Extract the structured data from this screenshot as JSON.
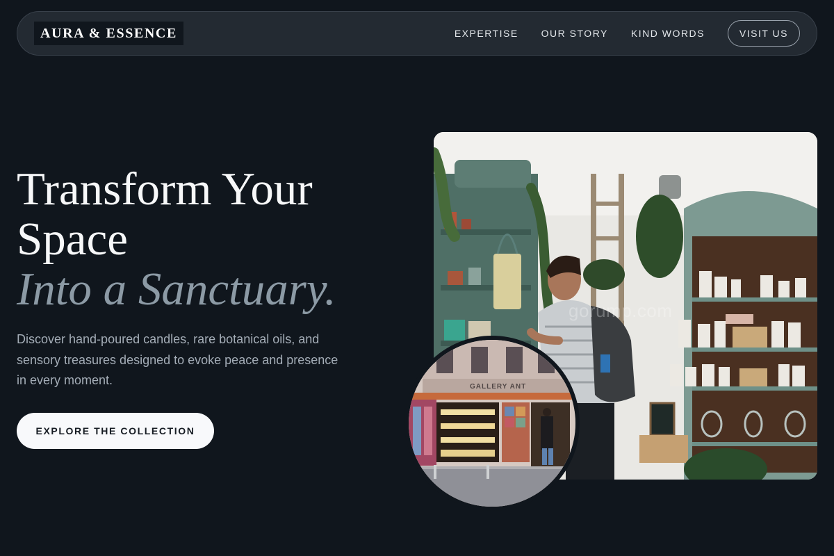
{
  "nav": {
    "logo": "AURA & ESSENCE",
    "links": [
      "EXPERTISE",
      "OUR STORY",
      "KIND WORDS"
    ],
    "cta": "VISIT US"
  },
  "hero": {
    "title_line1": "Transform Your",
    "title_line2": "Space",
    "title_accent": "Into a Sanctuary.",
    "description": "Discover hand-poured candles, rare botanical oils, and sensory treasures designed to evoke peace and presence in every moment.",
    "cta": "EXPLORE THE COLLECTION"
  },
  "images": {
    "main_photo": "shop-interior-photo",
    "circle_photo": "storefront-photo",
    "storefront_sign": "GALLERY ANT",
    "watermark": "gorump.com"
  },
  "colors": {
    "background": "#10161d",
    "nav_bg": "#232a32",
    "accent_text": "#8c9aa5",
    "cabinet": "#6f8f86"
  }
}
